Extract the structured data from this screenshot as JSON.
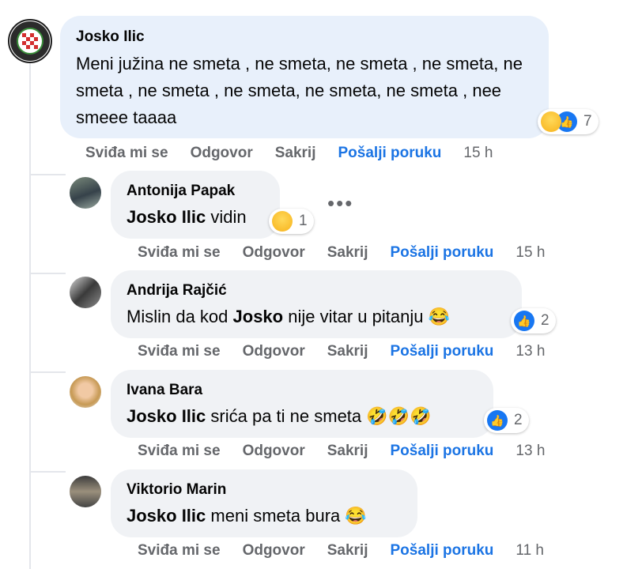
{
  "actions": {
    "like": "Sviđa mi se",
    "reply": "Odgovor",
    "hide": "Sakrij",
    "message": "Pošalji poruku"
  },
  "comments": [
    {
      "author": "Josko Ilic",
      "text": "Meni južina ne smeta , ne smeta, ne smeta , ne smeta, ne smeta , ne smeta , ne smeta, ne smeta, ne smeta , nee smeee taaaa",
      "reactions": [
        "haha-icon",
        "like-icon"
      ],
      "reaction_count": "7",
      "time": "15 h"
    },
    {
      "author": "Antonija Papak",
      "mention": "Josko Ilic",
      "text": "vidin",
      "reactions": [
        "haha-icon"
      ],
      "reaction_count": "1",
      "time": "15 h"
    },
    {
      "author": "Andrija Rajčić",
      "text_before": "Mislin da kod",
      "mention": "Josko",
      "text_after": "nije vitar u pitanju",
      "emoji": "😂",
      "reactions": [
        "like-icon"
      ],
      "reaction_count": "2",
      "time": "13 h"
    },
    {
      "author": "Ivana Bara",
      "mention": "Josko Ilic",
      "text": "srića pa ti ne smeta",
      "emoji": "🤣🤣🤣",
      "reactions": [
        "like-icon"
      ],
      "reaction_count": "2",
      "time": "13 h"
    },
    {
      "author": "Viktorio Marin",
      "mention": "Josko Ilic",
      "text": "meni smeta bura",
      "emoji": "😂",
      "time": "11 h"
    }
  ],
  "colors": {
    "bubble": "#f0f2f5",
    "main_bubble": "#e8f0fb",
    "link": "#1b74e4",
    "meta": "#65676b"
  }
}
